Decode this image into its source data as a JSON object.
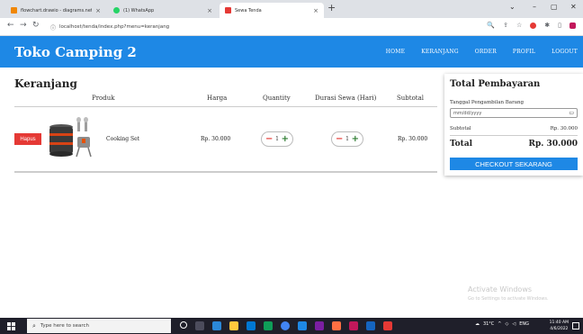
{
  "browser": {
    "tabs": [
      {
        "title": "flowchart.drawio - diagrams.net",
        "icon": "drawio-icon",
        "color": "#f08705"
      },
      {
        "title": "(1) WhatsApp",
        "icon": "whatsapp-icon",
        "color": "#25d366"
      },
      {
        "title": "Sewa Tenda",
        "icon": "tent-favicon",
        "color": "#e53935"
      }
    ],
    "url": "localhost/tenda/index.php?menu=keranjang"
  },
  "navbar": {
    "brand": "Toko Camping 2",
    "links": [
      "HOME",
      "KERANJANG",
      "ORDER",
      "PROFIL",
      "LOGOUT"
    ],
    "color": "#1e88e5"
  },
  "cart": {
    "heading": "Keranjang",
    "columns": {
      "produk": "Produk",
      "harga": "Harga",
      "quantity": "Quantity",
      "durasi": "Durasi Sewa (Hari)",
      "subtotal": "Subtotal"
    },
    "items": [
      {
        "delete_label": "Hapus",
        "name": "Cooking Set",
        "price": "Rp. 30.000",
        "quantity": "1",
        "duration": "1",
        "subtotal": "Rp. 30.000"
      }
    ]
  },
  "summary": {
    "title": "Total Pembayaran",
    "date_label": "Tanggal Pengambilan Barang",
    "date_placeholder": "mm/dd/yyyy",
    "subtotal_label": "Subtotal",
    "subtotal_value": "Rp. 30.000",
    "total_label": "Total",
    "total_value": "Rp. 30.000",
    "checkout_label": "CHECKOUT SEKARANG"
  },
  "watermark": {
    "title": "Activate Windows",
    "subtitle": "Go to Settings to activate Windows."
  },
  "taskbar": {
    "search_placeholder": "Type here to search",
    "weather": "31°C",
    "language": "ENG",
    "time": "11:40 AM",
    "date": "4/6/2022"
  }
}
